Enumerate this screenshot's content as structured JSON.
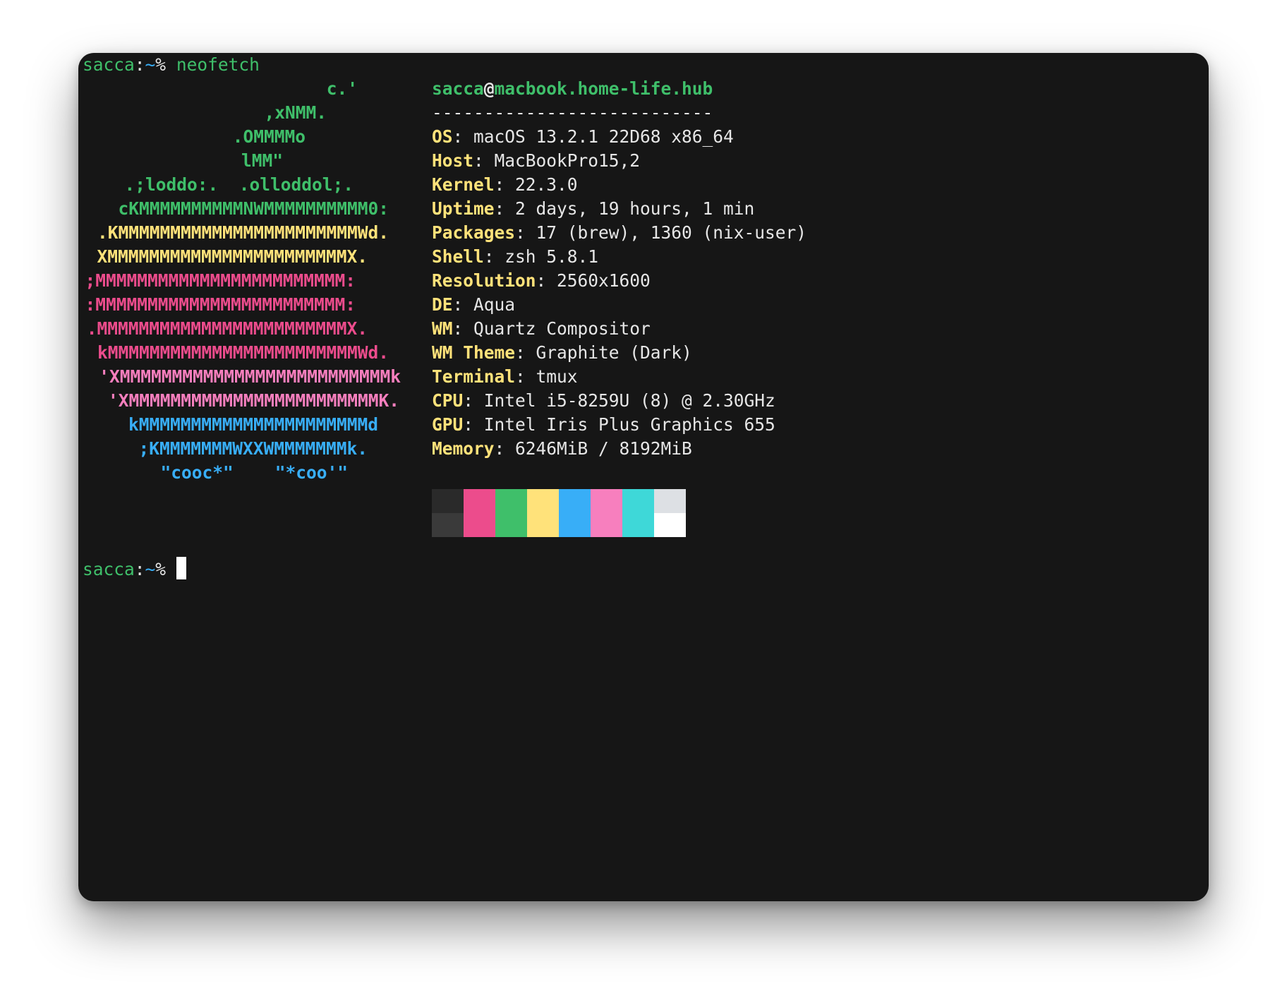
{
  "prompt": {
    "user": "sacca",
    "sep": ":",
    "path": "~",
    "symbol": "%",
    "command": "neofetch"
  },
  "logo_lines": [
    {
      "text": "c.'",
      "color": "#3fbf6a"
    },
    {
      "text": ",xNMM.",
      "color": "#3fbf6a"
    },
    {
      "text": ".OMMMMo",
      "color": "#3fbf6a"
    },
    {
      "text": "lMM\"",
      "color": "#3fbf6a"
    },
    {
      "text": ".;loddo:.  .olloddol;.",
      "color": "#3fbf6a"
    },
    {
      "text": "cKMMMMMMMMMMNWMMMMMMMMMM0:",
      "color": "#3fbf6a"
    },
    {
      "text": ".KMMMMMMMMMMMMMMMMMMMMMMMWd.",
      "color": "#ffe27a"
    },
    {
      "text": "XMMMMMMMMMMMMMMMMMMMMMMMX.",
      "color": "#ffe27a"
    },
    {
      "text": ";MMMMMMMMMMMMMMMMMMMMMMMM:",
      "color": "#ec4c8c"
    },
    {
      "text": ":MMMMMMMMMMMMMMMMMMMMMMMM:",
      "color": "#ec4c8c"
    },
    {
      "text": ".MMMMMMMMMMMMMMMMMMMMMMMMX.",
      "color": "#ec4c8c"
    },
    {
      "text": "kMMMMMMMMMMMMMMMMMMMMMMMMWd.",
      "color": "#ec4c8c"
    },
    {
      "text": "'XMMMMMMMMMMMMMMMMMMMMMMMMMMk",
      "color": "#f77fbe"
    },
    {
      "text": "'XMMMMMMMMMMMMMMMMMMMMMMMMK.",
      "color": "#f77fbe"
    },
    {
      "text": "kMMMMMMMMMMMMMMMMMMMMMMd",
      "color": "#38aef7"
    },
    {
      "text": ";KMMMMMMMWXXWMMMMMMMk.",
      "color": "#38aef7"
    },
    {
      "text": "\"cooc*\"    \"*coo'\"",
      "color": "#38aef7"
    }
  ],
  "info": {
    "user": "sacca",
    "at": "@",
    "host": "macbook.home-life.hub",
    "separator": "---------------------------",
    "items": [
      {
        "key": "OS",
        "value": "macOS 13.2.1 22D68 x86_64"
      },
      {
        "key": "Host",
        "value": "MacBookPro15,2"
      },
      {
        "key": "Kernel",
        "value": "22.3.0"
      },
      {
        "key": "Uptime",
        "value": "2 days, 19 hours, 1 min"
      },
      {
        "key": "Packages",
        "value": "17 (brew), 1360 (nix-user)"
      },
      {
        "key": "Shell",
        "value": "zsh 5.8.1"
      },
      {
        "key": "Resolution",
        "value": "2560x1600"
      },
      {
        "key": "DE",
        "value": "Aqua"
      },
      {
        "key": "WM",
        "value": "Quartz Compositor"
      },
      {
        "key": "WM Theme",
        "value": "Graphite (Dark)"
      },
      {
        "key": "Terminal",
        "value": "tmux"
      },
      {
        "key": "CPU",
        "value": "Intel i5-8259U (8) @ 2.30GHz"
      },
      {
        "key": "GPU",
        "value": "Intel Iris Plus Graphics 655"
      },
      {
        "key": "Memory",
        "value": "6246MiB / 8192MiB"
      }
    ]
  },
  "palette": {
    "normal": [
      "#2a2a2a",
      "#ec4c8c",
      "#3fbf6a",
      "#ffe27a",
      "#38aef7",
      "#f77fbe",
      "#3ed8d8",
      "#dde0e4"
    ],
    "bright": [
      "#3a3a3a",
      "#ec4c8c",
      "#3fbf6a",
      "#ffe27a",
      "#38aef7",
      "#f77fbe",
      "#3ed8d8",
      "#ffffff"
    ]
  },
  "prompt2": {
    "user": "sacca",
    "sep": ":",
    "path": "~",
    "symbol": "%"
  },
  "colors": {
    "background": "#161616",
    "green": "#3fbf6a",
    "yellow": "#ffe27a",
    "pink": "#ec4c8c",
    "light_pink": "#f77fbe",
    "blue": "#38aef7",
    "foreground": "#e6e6e6"
  }
}
